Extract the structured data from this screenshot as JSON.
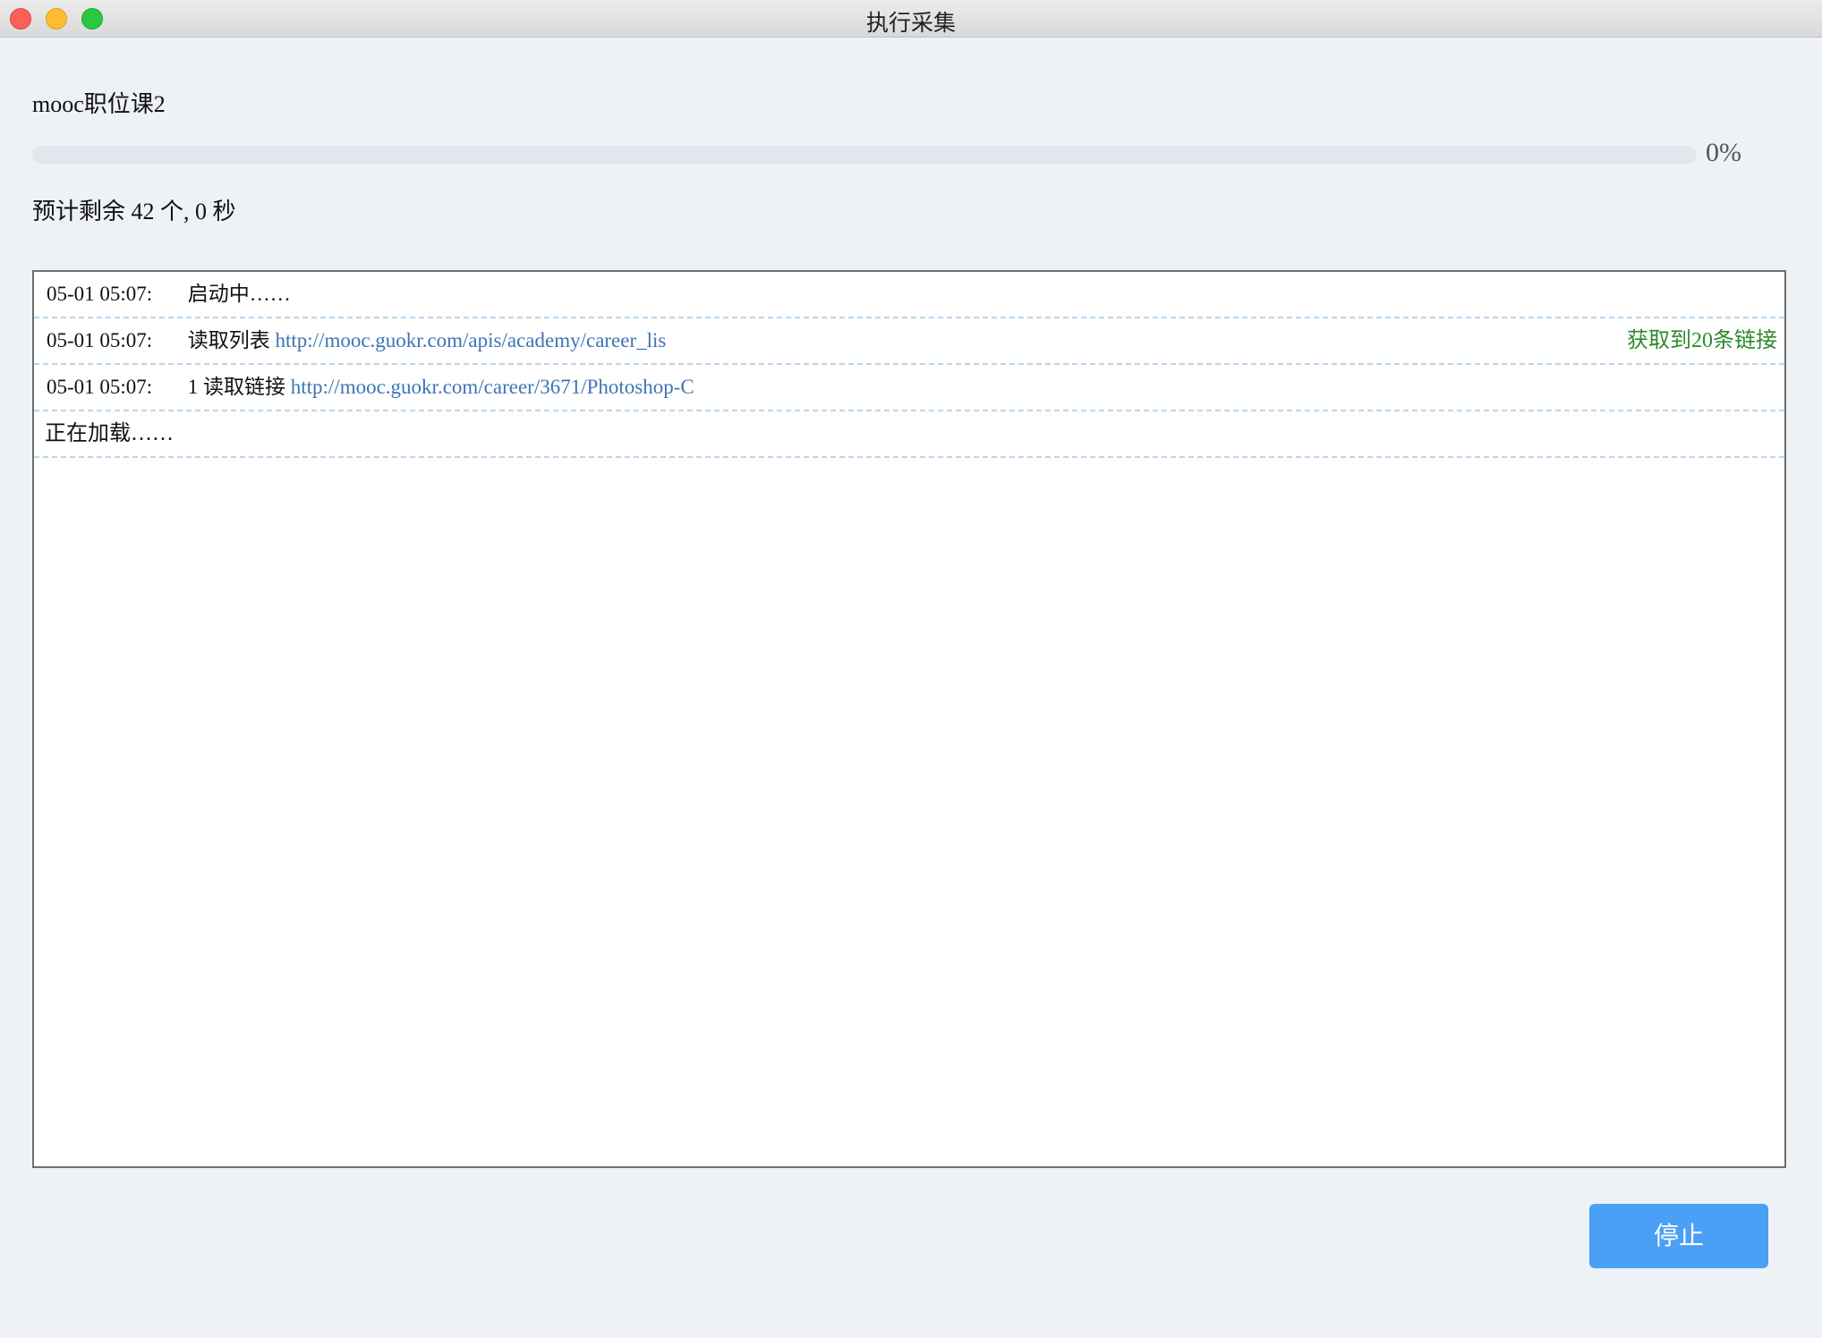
{
  "window": {
    "title": "执行采集"
  },
  "task": {
    "name": "mooc职位课2",
    "progress_percent": 0,
    "progress_label": "0%",
    "remaining_label": "预计剩余 42 个, 0 秒"
  },
  "log": {
    "rows": [
      {
        "time": "05-01 05:07:",
        "message": "启动中……",
        "link": "",
        "result": ""
      },
      {
        "time": "05-01 05:07:",
        "message": "读取列表",
        "link": "http://mooc.guokr.com/apis/academy/career_lis",
        "result": "获取到20条链接"
      },
      {
        "time": "05-01 05:07:",
        "message": "1 读取链接",
        "link": "http://mooc.guokr.com/career/3671/Photoshop-C",
        "result": ""
      }
    ],
    "loading_text": "正在加载……"
  },
  "actions": {
    "stop_label": "停止"
  },
  "colors": {
    "accent": "#4aa0f5",
    "link": "#3d74b6",
    "success": "#2d8a2b"
  }
}
